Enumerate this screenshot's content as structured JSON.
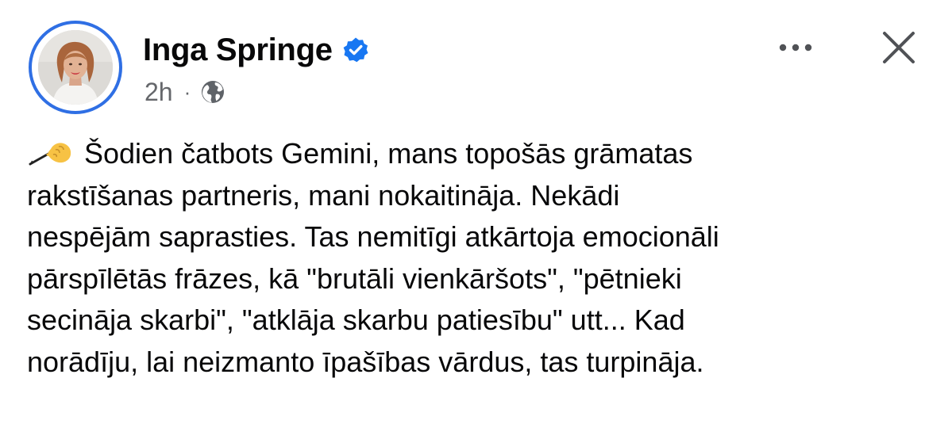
{
  "post": {
    "author": {
      "name": "Inga Springe",
      "avatar_icon": "profile-photo",
      "verified_icon": "verified-badge-icon",
      "story_ring_color": "#2f6fe4"
    },
    "meta": {
      "time": "2h",
      "separator": "·",
      "audience_icon": "globe-icon"
    },
    "actions": {
      "more_icon": "more-options-icon",
      "close_icon": "close-icon"
    },
    "body": {
      "emoji_icon": "writing-hand-icon",
      "lines": [
        "Šodien čatbots Gemini, mans topošās grāmatas",
        "rakstīšanas partneris, mani nokaitināja. Nekādi",
        "nespējām saprasties. Tas nemitīgi atkārtoja emocionāli",
        "pārspīlētās frāzes, kā \"brutāli vienkāršots\", \"pētnieki",
        "secināja skarbi\", \"atklāja skarbu patiesību\" utt... Kad",
        "norādīju, lai neizmanto īpašības vārdus, tas turpināja."
      ]
    }
  }
}
